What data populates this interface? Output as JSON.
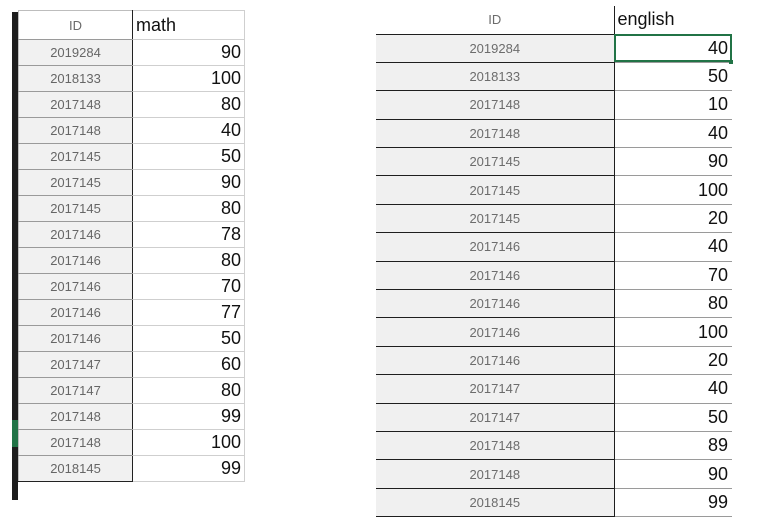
{
  "math_sheet": {
    "header": {
      "id": "ID",
      "value": "math"
    },
    "rows": [
      {
        "id": "2019284",
        "value": "90"
      },
      {
        "id": "2018133",
        "value": "100"
      },
      {
        "id": "2017148",
        "value": "80"
      },
      {
        "id": "2017148",
        "value": "40"
      },
      {
        "id": "2017145",
        "value": "50"
      },
      {
        "id": "2017145",
        "value": "90"
      },
      {
        "id": "2017145",
        "value": "80"
      },
      {
        "id": "2017146",
        "value": "78"
      },
      {
        "id": "2017146",
        "value": "80"
      },
      {
        "id": "2017146",
        "value": "70"
      },
      {
        "id": "2017146",
        "value": "77"
      },
      {
        "id": "2017146",
        "value": "50"
      },
      {
        "id": "2017147",
        "value": "60"
      },
      {
        "id": "2017147",
        "value": "80"
      },
      {
        "id": "2017148",
        "value": "99"
      },
      {
        "id": "2017148",
        "value": "100"
      },
      {
        "id": "2018145",
        "value": "99"
      }
    ]
  },
  "english_sheet": {
    "header": {
      "id": "ID",
      "value": "english"
    },
    "rows": [
      {
        "id": "2019284",
        "value": "40"
      },
      {
        "id": "2018133",
        "value": "50"
      },
      {
        "id": "2017148",
        "value": "10"
      },
      {
        "id": "2017148",
        "value": "40"
      },
      {
        "id": "2017145",
        "value": "90"
      },
      {
        "id": "2017145",
        "value": "100"
      },
      {
        "id": "2017145",
        "value": "20"
      },
      {
        "id": "2017146",
        "value": "40"
      },
      {
        "id": "2017146",
        "value": "70"
      },
      {
        "id": "2017146",
        "value": "80"
      },
      {
        "id": "2017146",
        "value": "100"
      },
      {
        "id": "2017146",
        "value": "20"
      },
      {
        "id": "2017147",
        "value": "40"
      },
      {
        "id": "2017147",
        "value": "50"
      },
      {
        "id": "2017148",
        "value": "89"
      },
      {
        "id": "2017148",
        "value": "90"
      },
      {
        "id": "2018145",
        "value": "99"
      }
    ]
  },
  "colors": {
    "selection": "#217346",
    "id_cell_bg": "#f0f0f0"
  }
}
